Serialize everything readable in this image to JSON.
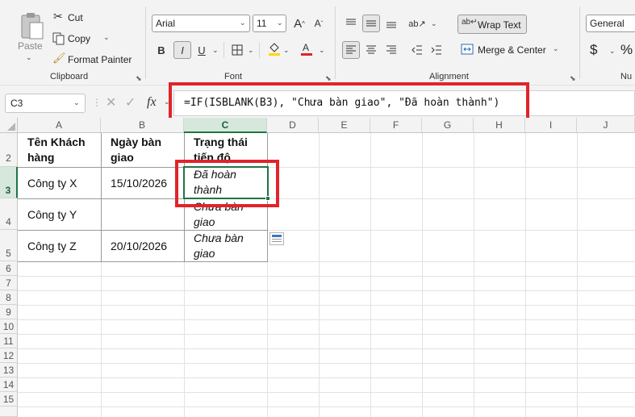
{
  "clipboard": {
    "paste": "Paste",
    "cut": "Cut",
    "copy": "Copy",
    "format_painter": "Format Painter",
    "label": "Clipboard"
  },
  "font": {
    "name": "Arial",
    "size": "11",
    "bold": "B",
    "italic": "I",
    "underline": "U",
    "label": "Font",
    "grow": "A",
    "shrink": "A"
  },
  "alignment": {
    "wrap_text": "Wrap Text",
    "merge_center": "Merge & Center",
    "label": "Alignment"
  },
  "number": {
    "format": "General",
    "currency": "$",
    "percent": "%",
    "label": "Nu"
  },
  "formula_bar": {
    "name_box": "C3",
    "fx": "fx",
    "formula": "=IF(ISBLANK(B3), \"Chưa bàn giao\", \"Đã hoàn thành\")"
  },
  "columns": [
    "A",
    "B",
    "C",
    "D",
    "E",
    "F",
    "G",
    "H",
    "I",
    "J"
  ],
  "rows": [
    "2",
    "3",
    "4",
    "5",
    "6",
    "7",
    "8",
    "9",
    "10",
    "11",
    "12",
    "13",
    "14",
    "15"
  ],
  "table": {
    "headers": [
      "Tên Khách hàng",
      "Ngày bàn giao",
      "Trạng thái tiến độ"
    ],
    "rows": [
      [
        "Công ty X",
        "15/10/2026",
        "Đã hoàn thành"
      ],
      [
        "Công ty Y",
        "",
        "Chưa bàn giao"
      ],
      [
        "Công ty Z",
        "20/10/2026",
        "Chưa bàn giao"
      ]
    ]
  },
  "colors": {
    "highlight_red": "#e0242a",
    "selection_green": "#217346",
    "font_color": "#e0242a",
    "fill_color": "#ffd800"
  }
}
